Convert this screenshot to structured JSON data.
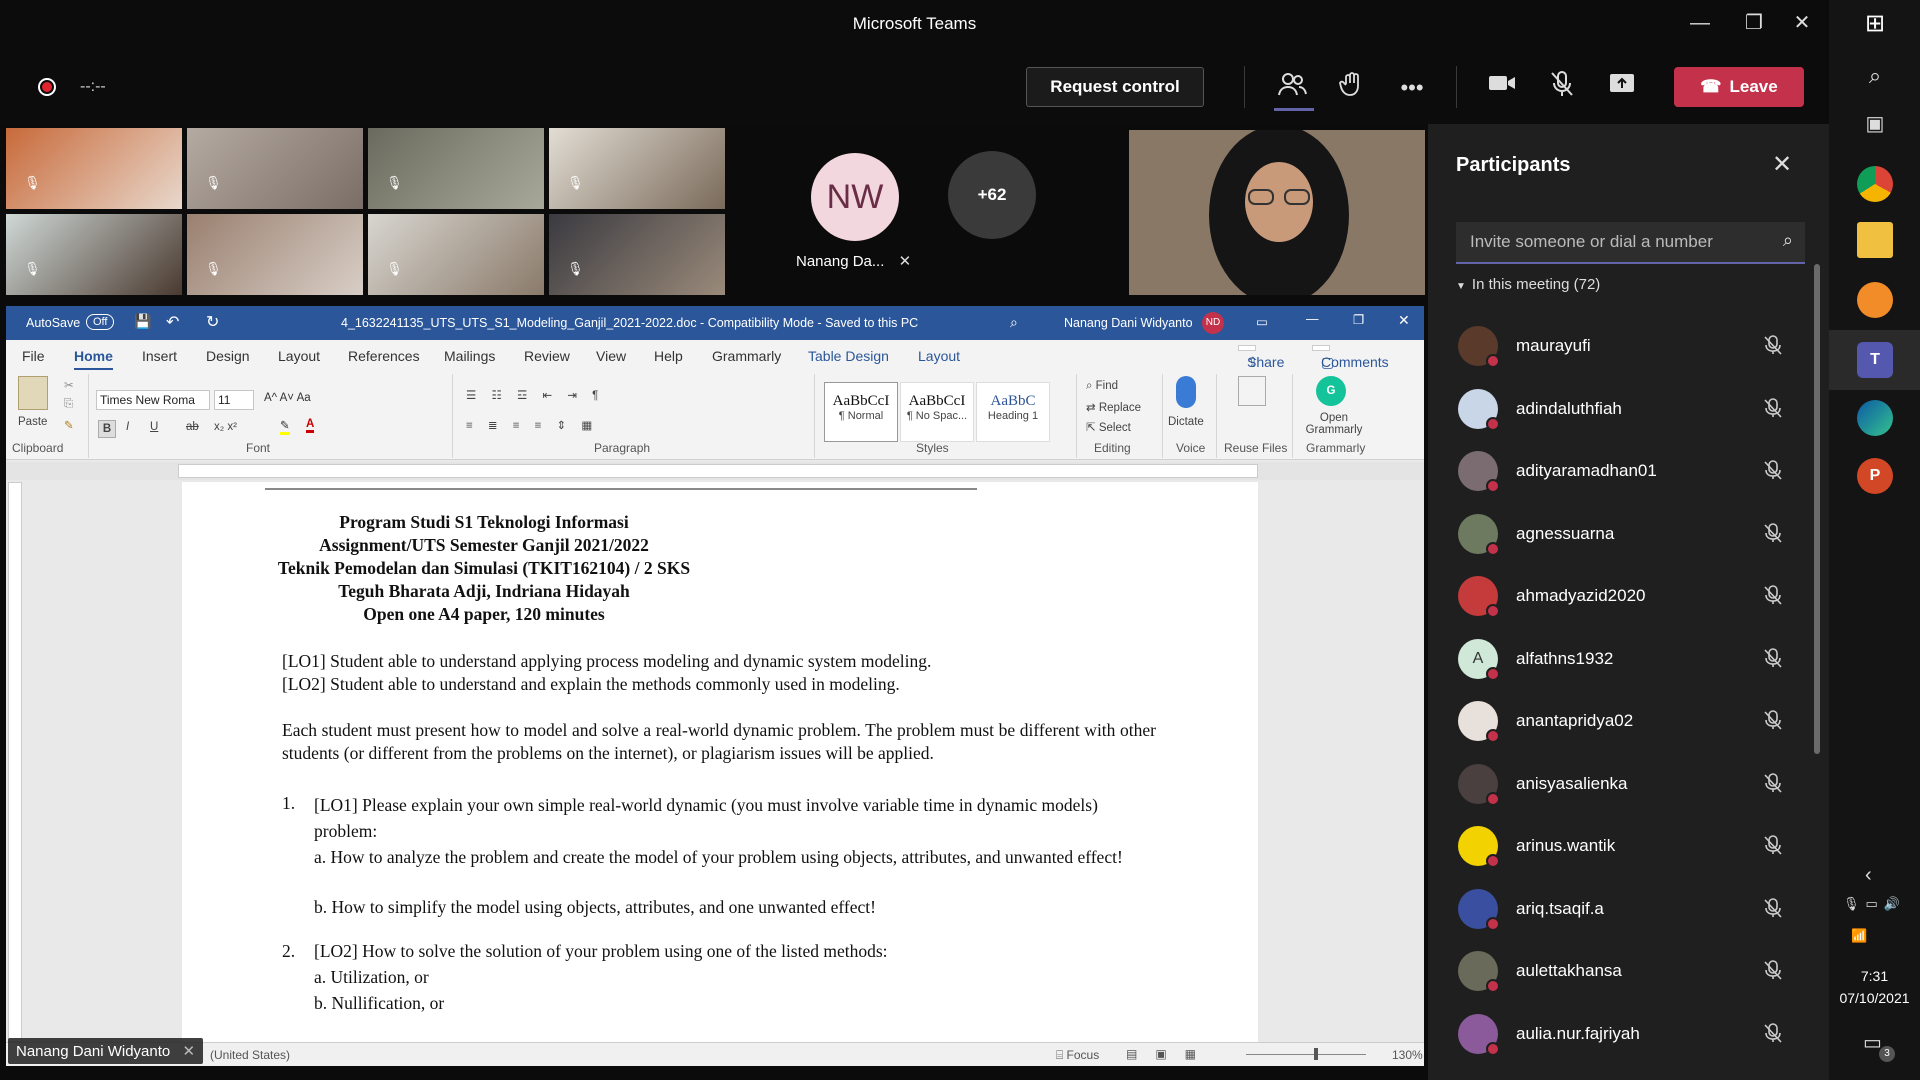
{
  "window": {
    "title": "Microsoft Teams"
  },
  "toolbar": {
    "timer": "--:--",
    "request_control_label": "Request control",
    "leave_label": "Leave"
  },
  "gallery": {
    "presenter_initials": "NW",
    "presenter_name": "Nanang Da...",
    "overflow_count": "+62"
  },
  "word": {
    "autosave_label": "AutoSave",
    "autosave_state": "Off",
    "doc_title": "4_1632241135_UTS_UTS_S1_Modeling_Ganjil_2021-2022.doc  -  Compatibility Mode  -  Saved to this PC",
    "user_name": "Nanang Dani Widyanto",
    "user_initials": "ND",
    "tabs": [
      "File",
      "Home",
      "Insert",
      "Design",
      "Layout",
      "References",
      "Mailings",
      "Review",
      "View",
      "Help",
      "Grammarly",
      "Table Design",
      "Layout"
    ],
    "share_label": "Share",
    "comments_label": "Comments",
    "font_name": "Times New Roma",
    "font_size": "11",
    "paste_label": "Paste",
    "styles": [
      {
        "preview": "AaBbCcI",
        "label": "¶ Normal"
      },
      {
        "preview": "AaBbCcI",
        "label": "¶ No Spac..."
      },
      {
        "preview": "AaBbC",
        "label": "Heading 1"
      }
    ],
    "editing": {
      "find": "Find",
      "replace": "Replace",
      "select": "Select"
    },
    "dictate_label": "Dictate",
    "reuse_label": "Reuse Files",
    "grammarly_label": "Open Grammarly",
    "groups": [
      "Clipboard",
      "Font",
      "Paragraph",
      "Styles",
      "Editing",
      "Voice",
      "Reuse Files",
      "Grammarly"
    ],
    "status_lang": "(United States)",
    "status_focus": "Focus",
    "zoom": "130%"
  },
  "document": {
    "header": [
      "Program Studi S1 Teknologi Informasi",
      "Assignment/UTS Semester Ganjil 2021/2022",
      "Teknik Pemodelan dan Simulasi (TKIT162104) / 2 SKS",
      "Teguh Bharata Adji, Indriana Hidayah",
      "Open one A4 paper, 120 minutes"
    ],
    "lo1": "[LO1] Student able to understand applying process modeling and dynamic system modeling.",
    "lo2": "[LO2] Student able to understand and explain the methods commonly used in modeling.",
    "intro": "Each student must present how to model and solve a real-world dynamic problem. The problem must be different with other students (or different from the problems on the internet), or plagiarism issues will be applied.",
    "q1_num": "1.",
    "q1": "[LO1] Please explain your own simple real-world dynamic (you must involve variable time in dynamic models) problem:",
    "q1a": "a. How to analyze the problem and create the model of your problem using objects, attributes, and unwanted effect!",
    "q1b": "b. How to simplify the model using objects, attributes, and one unwanted effect!",
    "q2_num": "2.",
    "q2": "[LO2] How to solve the solution of your problem using one of the listed methods:",
    "q2a": "a. Utilization, or",
    "q2b": "b. Nullification, or"
  },
  "presenter_label": "Nanang Dani Widyanto",
  "participants": {
    "title": "Participants",
    "search_placeholder": "Invite someone or dial a number",
    "in_meeting": "In this meeting (72)",
    "list": [
      {
        "name": "maurayufi",
        "color": "#5a3a2a"
      },
      {
        "name": "adindaluthfiah",
        "color": "#c9d6e8"
      },
      {
        "name": "adityaramadhan01",
        "color": "#7a6c70"
      },
      {
        "name": "agnessuarna",
        "color": "#6e7a60"
      },
      {
        "name": "ahmadyazid2020",
        "color": "#c53a3a"
      },
      {
        "name": "alfathns1932",
        "color": "#cfe8d8",
        "initial": "A"
      },
      {
        "name": "anantapridya02",
        "color": "#e8e0da"
      },
      {
        "name": "anisyasalienka",
        "color": "#4a4040"
      },
      {
        "name": "arinus.wantik",
        "color": "#f2d200"
      },
      {
        "name": "ariq.tsaqif.a",
        "color": "#3a4fa0"
      },
      {
        "name": "aulettakhansa",
        "color": "#6a6a5a"
      },
      {
        "name": "aulia.nur.fajriyah",
        "color": "#8a5a9a"
      }
    ]
  },
  "tray": {
    "time": "7:31",
    "date": "07/10/2021",
    "notifications": "3"
  }
}
